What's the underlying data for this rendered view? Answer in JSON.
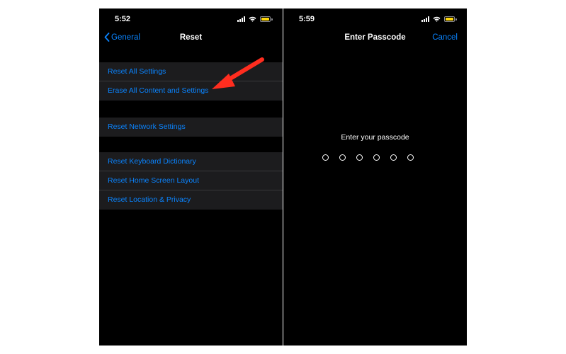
{
  "left_screen": {
    "status": {
      "time": "5:52"
    },
    "nav": {
      "back_label": "General",
      "title": "Reset"
    },
    "groups": [
      [
        "Reset All Settings",
        "Erase All Content and Settings"
      ],
      [
        "Reset Network Settings"
      ],
      [
        "Reset Keyboard Dictionary",
        "Reset Home Screen Layout",
        "Reset Location & Privacy"
      ]
    ]
  },
  "right_screen": {
    "status": {
      "time": "5:59"
    },
    "nav": {
      "title": "Enter Passcode",
      "cancel_label": "Cancel"
    },
    "prompt": "Enter your passcode",
    "passcode_length": 6
  },
  "colors": {
    "background": "#000000",
    "group_background": "#1c1c1e",
    "accent": "#0a84ff",
    "separator": "#38383a",
    "battery": "#ffd60a",
    "annotation_arrow": "#ff2d1f"
  },
  "icons": [
    "chevron-left-icon",
    "signal-icon",
    "wifi-icon",
    "battery-icon",
    "annotation-arrow"
  ]
}
